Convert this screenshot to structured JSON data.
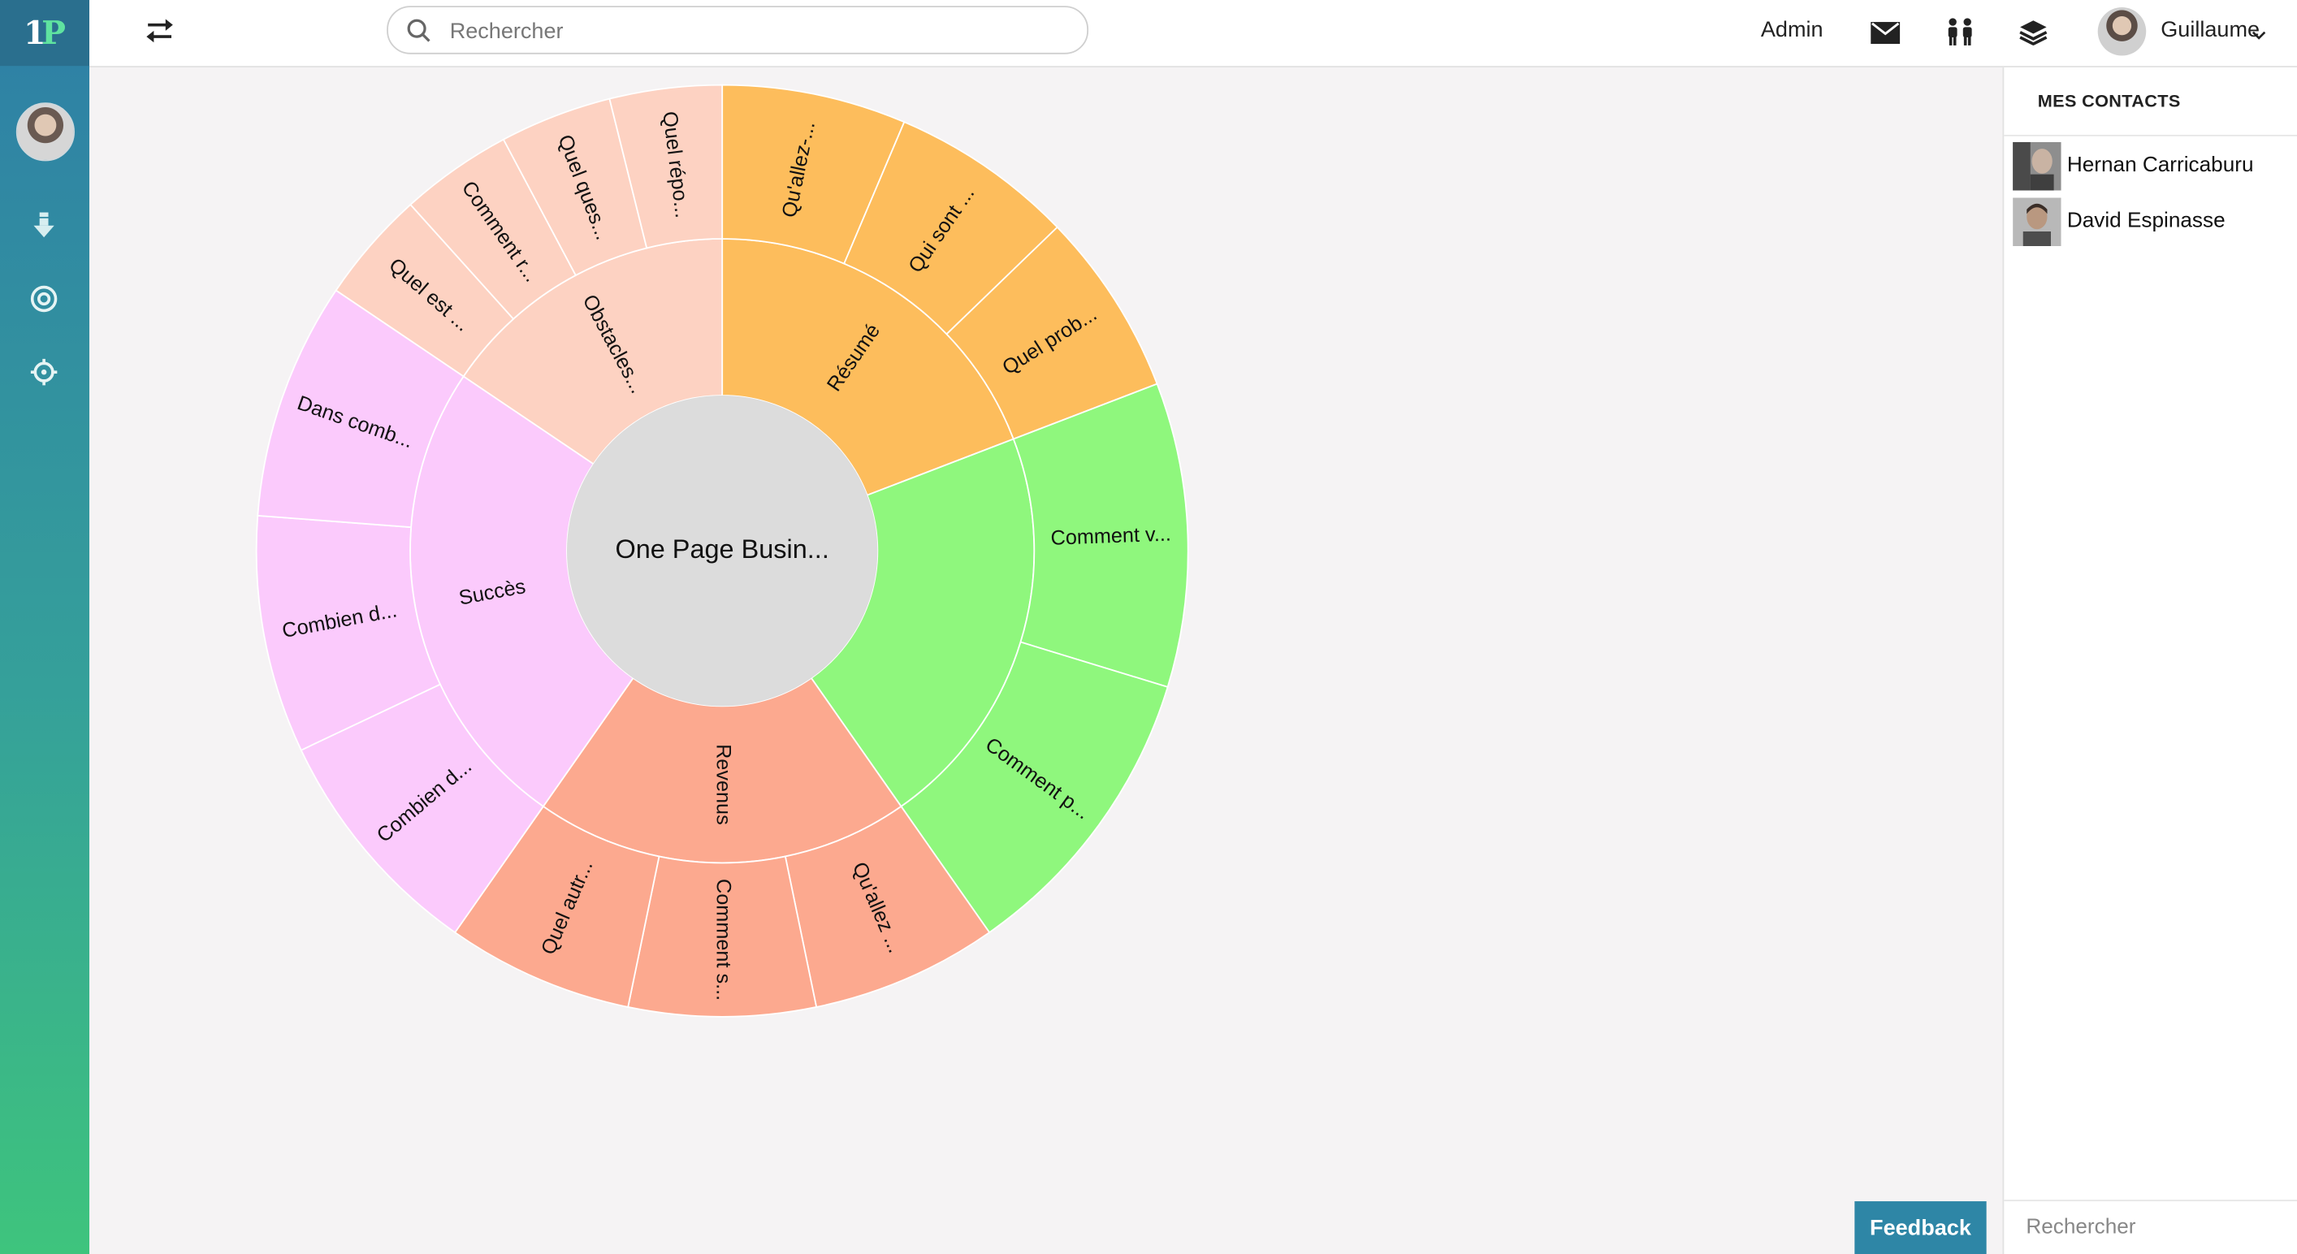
{
  "app": {
    "logo_letter_1": "1",
    "logo_letter_2": "P"
  },
  "rail": {
    "items": [
      {
        "icon": "download-icon"
      },
      {
        "icon": "target-icon"
      },
      {
        "icon": "crosshair-icon"
      }
    ]
  },
  "topbar": {
    "search_placeholder": "Rechercher",
    "admin_label": "Admin",
    "user_name": "Guillaume"
  },
  "contacts": {
    "title": "MES CONTACTS",
    "items": [
      {
        "name": "Hernan Carricaburu"
      },
      {
        "name": "David Espinasse"
      }
    ],
    "search_placeholder": "Rechercher"
  },
  "feedback_label": "Feedback",
  "chart_data": {
    "type": "sunburst",
    "center": "One Page Busin...",
    "groups": [
      {
        "name": "Résumé",
        "color": "#fdbd5c",
        "children": [
          "Qu'allez-...",
          "Qui sont ...",
          "Quel prob..."
        ]
      },
      {
        "name": "",
        "color": "#8ff77d",
        "children": [
          "Comment v...",
          "Comment p..."
        ]
      },
      {
        "name": "Revenus",
        "color": "#fca98f",
        "children": [
          "Qu'allez ...",
          "Comment s...",
          "Quel autr..."
        ]
      },
      {
        "name": "Succès",
        "color": "#fbcafc",
        "children": [
          "Combien d...",
          "Combien d...",
          "Dans comb..."
        ]
      },
      {
        "name": "Obstacles...",
        "color": "#fdd2c2",
        "children": [
          "Quel est ...",
          "Comment r...",
          "Quel ques...",
          "Quel répo..."
        ]
      }
    ]
  }
}
